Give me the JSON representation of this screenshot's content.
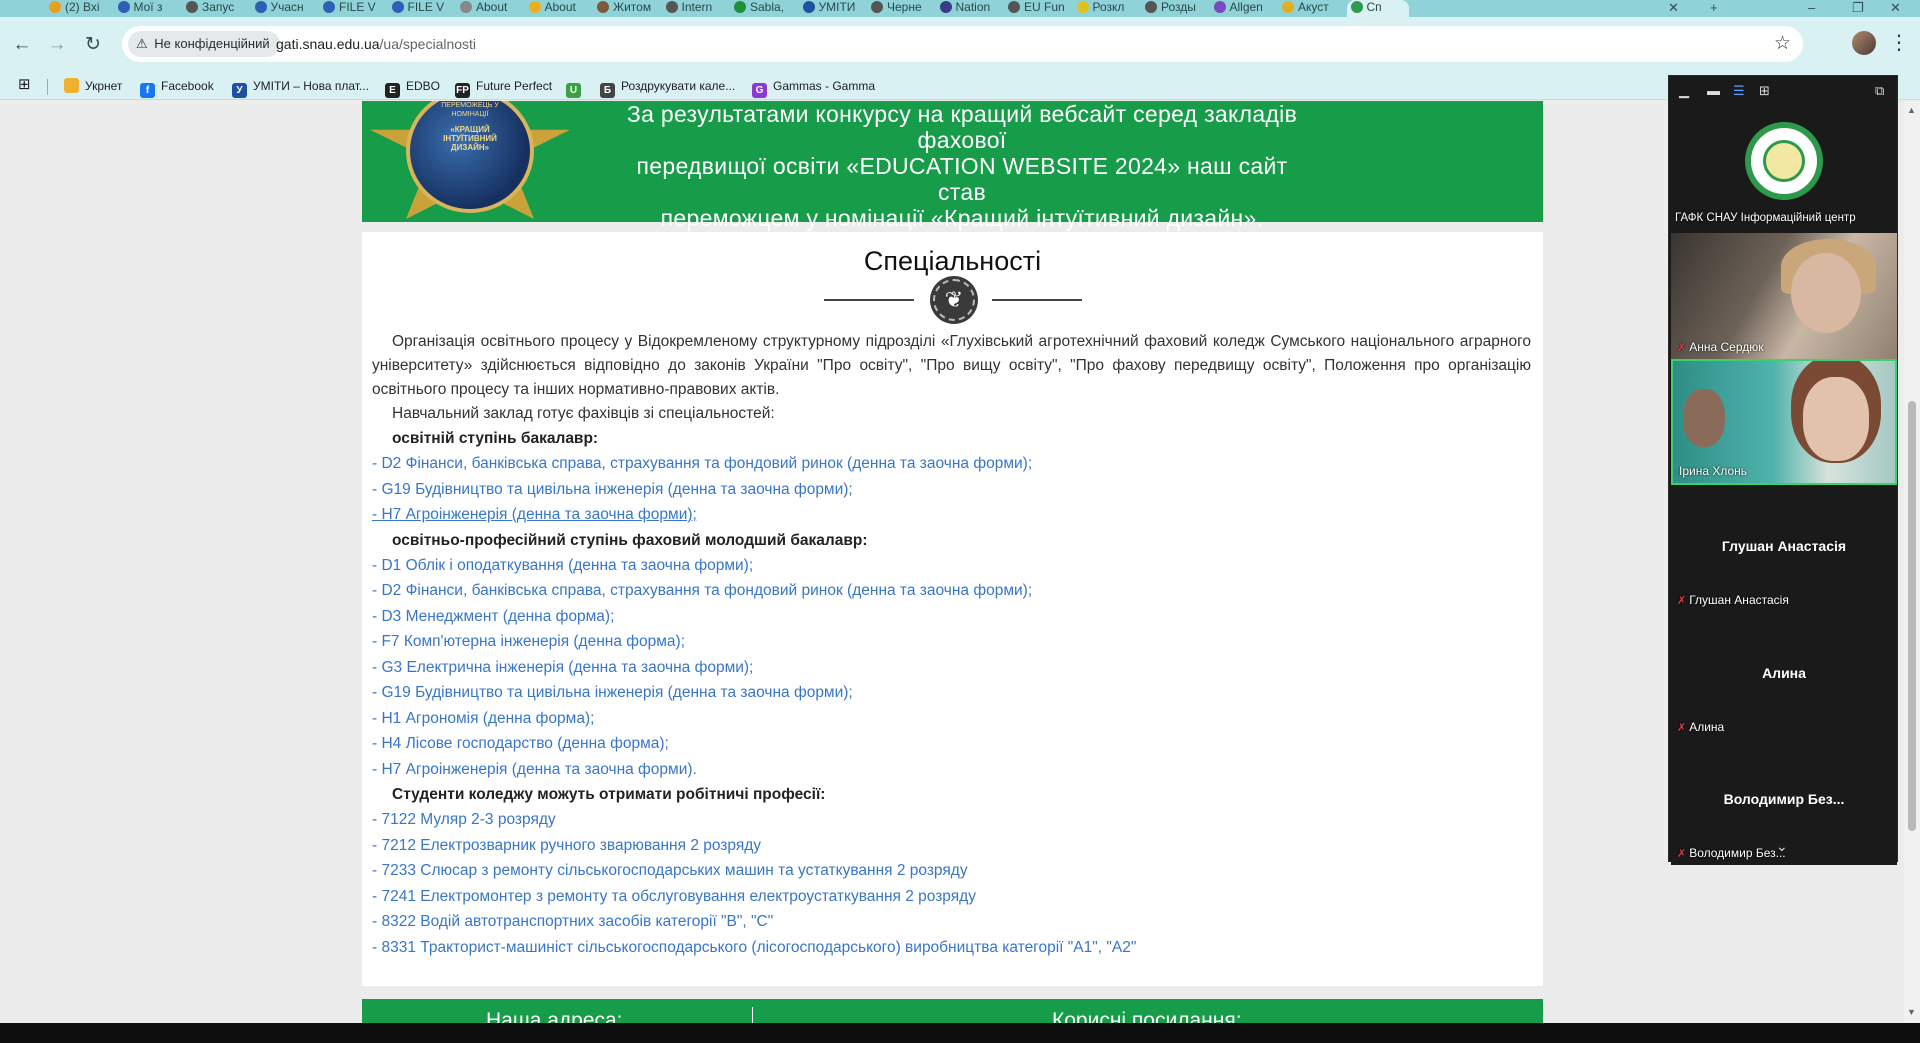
{
  "browser": {
    "tabs": [
      {
        "label": "(2) Вхі",
        "color": "#e8a020"
      },
      {
        "label": "Мої з",
        "color": "#2f5fb5"
      },
      {
        "label": "Запус",
        "color": "#555555"
      },
      {
        "label": "Учасн",
        "color": "#2f5fb5"
      },
      {
        "label": "FILE V",
        "color": "#2f5fb5"
      },
      {
        "label": "FILE V",
        "color": "#2f5fb5"
      },
      {
        "label": "About",
        "color": "#888888"
      },
      {
        "label": "About",
        "color": "#e8b020"
      },
      {
        "label": "Житом",
        "color": "#7a5a3a"
      },
      {
        "label": "Intern",
        "color": "#555555"
      },
      {
        "label": "Sabla,",
        "color": "#1f8f3a"
      },
      {
        "label": "УМІТИ",
        "color": "#2050a0"
      },
      {
        "label": "Черне",
        "color": "#555555"
      },
      {
        "label": "Nation",
        "color": "#3a3a8a"
      },
      {
        "label": "EU Fun",
        "color": "#555555"
      },
      {
        "label": "Розкл",
        "color": "#e0c020"
      },
      {
        "label": "Розды",
        "color": "#555555"
      },
      {
        "label": "Allgen",
        "color": "#7a4ac0"
      },
      {
        "label": "Акуст",
        "color": "#e0b020"
      },
      {
        "label": "Сп",
        "color": "#2e9a50"
      }
    ],
    "security_label": "Не конфіденційний",
    "url_domain": "gati.snau.edu.ua",
    "url_path": "/ua/specialnosti",
    "bookmarks": [
      {
        "label": "Укрнет",
        "color": "#f0b030",
        "glyph": ""
      },
      {
        "label": "Facebook",
        "color": "#1877f2",
        "glyph": "f"
      },
      {
        "label": "УМІТИ – Нова плат...",
        "color": "#2050a0",
        "glyph": "У"
      },
      {
        "label": "EDBO",
        "color": "#222222",
        "glyph": "E"
      },
      {
        "label": "Future Perfect",
        "color": "#222222",
        "glyph": "FP"
      },
      {
        "label": "",
        "color": "#3aa046",
        "glyph": "U"
      },
      {
        "label": "Роздрукувати кале...",
        "color": "#444444",
        "glyph": "Б"
      },
      {
        "label": "Gammas - Gamma",
        "color": "#8a3ad0",
        "glyph": "G"
      }
    ]
  },
  "page": {
    "banner_lines": [
      "За результатами конкурсу на кращий вебсайт серед закладів фахової",
      "передвищої освіти «EDUCATION WEBSITE 2024» наш сайт став",
      "переможцем у номінації «Кращий інтуїтивний дизайн»."
    ],
    "medal_text": "ПЕРЕМОЖЕЦЬ У НОМІНАЦІЇ",
    "medal_sub": "«КРАЩИЙ ІНТУЇТИВНИЙ ДИЗАЙН»",
    "title": "Спеціальності",
    "intro": "Організація освітнього процесу у Відокремленому структурному підрозділі «Глухівський агротехнічний фаховий коледж Сумського національного аграрного університету» здійснюється відповідно до законів України \"Про освіту\", \"Про вищу освіту\", \"Про фахову передвищу освіту\", Положення про організацію освітнього процесу та інших нормативно-правових актів.",
    "prepares": "Навчальний заклад готує фахівців зі спеціальностей:",
    "sections": [
      {
        "heading": "освітній ступінь бакалавр:",
        "items": [
          "- D2 Фінанси, банківська справа, страхування та фондовий ринок (денна та заочна форми);",
          "- G19 Будівництво та цивільна інженерія (денна та заочна форми);",
          "- H7 Агроінженерія (денна та заочна форми);"
        ]
      },
      {
        "heading": "освітньо-професійний ступінь фаховий молодший бакалавр:",
        "items": [
          "- D1 Облік і оподаткування (денна та заочна форми);",
          "- D2 Фінанси, банківська справа, страхування та фондовий ринок (денна та заочна форми);",
          "- D3 Менеджмент (денна форма);",
          "- F7 Комп'ютерна інженерія (денна форма);",
          "- G3 Електрична інженерія (денна та заочна форми);",
          "- G19 Будівництво та цивільна інженерія (денна та заочна форми);",
          "- H1 Агрономія (денна форма);",
          "- H4 Лісове господарство (денна форма);",
          "- H7 Агроінженерія (денна та заочна форми)."
        ]
      },
      {
        "heading": "Студенти коледжу можуть отримати робітничі професії:",
        "items": [
          "- 7122 Муляр 2-3 розряду",
          "- 7212 Електрозварник ручного зварювання 2 розряду",
          "- 7233 Слюсар з ремонту сільськогосподарських машин та устаткування 2 розряду",
          "- 7241 Електромонтер з ремонту та обслуговування електроустаткування 2 розряду",
          "- 8322 Водій автотранспортних засобів категорії \"В\", \"С\"",
          "- 8331 Тракторист-машиніст сільськогосподарського (лісогосподарського) виробництва категорії \"А1\", \"А2\""
        ]
      }
    ],
    "footer_left": "Наша адреса:",
    "footer_right": "Корисні посилання:"
  },
  "zoom": {
    "participants": [
      {
        "name": "ГАФК СНАУ Інформаційний центр",
        "muted": false,
        "kind": "logo"
      },
      {
        "name": "Анна Сердюк",
        "muted": true,
        "kind": "video1"
      },
      {
        "name": "Ірина Хлонь",
        "muted": false,
        "kind": "video2"
      },
      {
        "name": "Глушан Анастасія",
        "muted": true,
        "kind": "noVideo",
        "center": "Глушан Анастасія"
      },
      {
        "name": "Алина",
        "muted": true,
        "kind": "noVideo",
        "center": "Алина"
      },
      {
        "name": "Володимир Без...",
        "muted": true,
        "kind": "noVideo",
        "center": "Володимир  Без..."
      }
    ]
  },
  "colors": {
    "accent_green": "#179c49",
    "link_blue": "#3876c8",
    "chrome_teal": "#d9f1f2"
  }
}
